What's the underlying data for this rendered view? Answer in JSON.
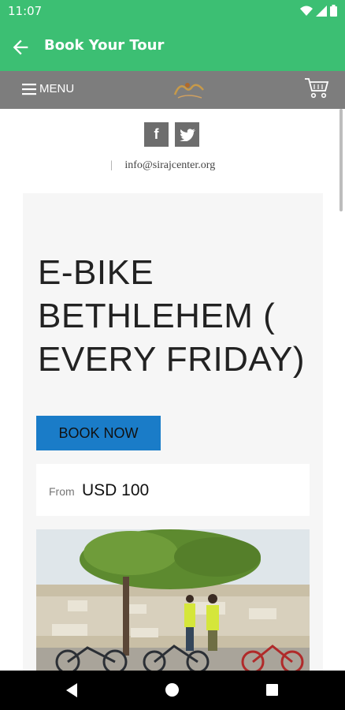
{
  "status_bar": {
    "time": "11:07"
  },
  "app_bar": {
    "title": "Book Your Tour"
  },
  "menu_bar": {
    "menu_label": "MENU"
  },
  "contact": {
    "email": "info@sirajcenter.org"
  },
  "tour": {
    "title": "E-BIKE BETHLEHEM ( EVERY FRIDAY)",
    "book_label": "BOOK NOW",
    "price_from": "From",
    "price": "USD 100"
  },
  "colors": {
    "app_bar": "#3cbf73",
    "menu_bar": "#7d7d7d",
    "book_button": "#1a7cc8"
  }
}
